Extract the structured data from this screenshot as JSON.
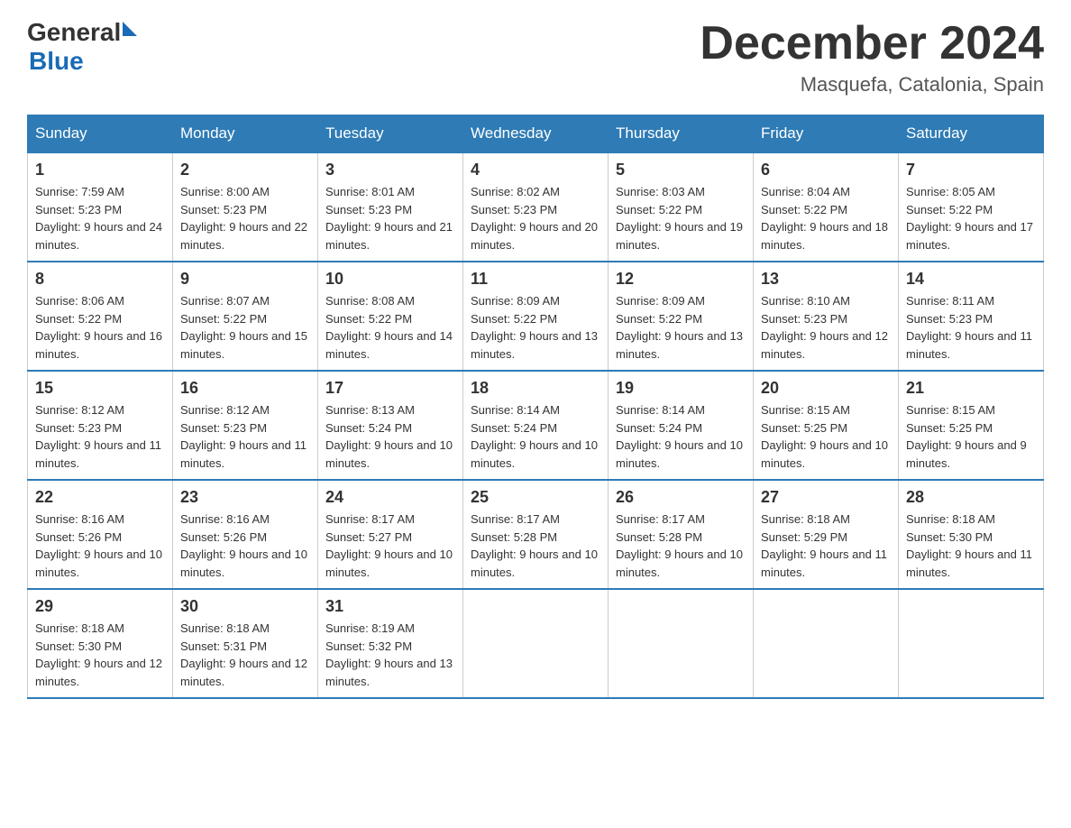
{
  "header": {
    "logo_general": "General",
    "logo_blue": "Blue",
    "month_title": "December 2024",
    "location": "Masquefa, Catalonia, Spain"
  },
  "calendar": {
    "columns": [
      "Sunday",
      "Monday",
      "Tuesday",
      "Wednesday",
      "Thursday",
      "Friday",
      "Saturday"
    ],
    "weeks": [
      [
        {
          "day": "1",
          "sunrise": "7:59 AM",
          "sunset": "5:23 PM",
          "daylight": "9 hours and 24 minutes."
        },
        {
          "day": "2",
          "sunrise": "8:00 AM",
          "sunset": "5:23 PM",
          "daylight": "9 hours and 22 minutes."
        },
        {
          "day": "3",
          "sunrise": "8:01 AM",
          "sunset": "5:23 PM",
          "daylight": "9 hours and 21 minutes."
        },
        {
          "day": "4",
          "sunrise": "8:02 AM",
          "sunset": "5:23 PM",
          "daylight": "9 hours and 20 minutes."
        },
        {
          "day": "5",
          "sunrise": "8:03 AM",
          "sunset": "5:22 PM",
          "daylight": "9 hours and 19 minutes."
        },
        {
          "day": "6",
          "sunrise": "8:04 AM",
          "sunset": "5:22 PM",
          "daylight": "9 hours and 18 minutes."
        },
        {
          "day": "7",
          "sunrise": "8:05 AM",
          "sunset": "5:22 PM",
          "daylight": "9 hours and 17 minutes."
        }
      ],
      [
        {
          "day": "8",
          "sunrise": "8:06 AM",
          "sunset": "5:22 PM",
          "daylight": "9 hours and 16 minutes."
        },
        {
          "day": "9",
          "sunrise": "8:07 AM",
          "sunset": "5:22 PM",
          "daylight": "9 hours and 15 minutes."
        },
        {
          "day": "10",
          "sunrise": "8:08 AM",
          "sunset": "5:22 PM",
          "daylight": "9 hours and 14 minutes."
        },
        {
          "day": "11",
          "sunrise": "8:09 AM",
          "sunset": "5:22 PM",
          "daylight": "9 hours and 13 minutes."
        },
        {
          "day": "12",
          "sunrise": "8:09 AM",
          "sunset": "5:22 PM",
          "daylight": "9 hours and 13 minutes."
        },
        {
          "day": "13",
          "sunrise": "8:10 AM",
          "sunset": "5:23 PM",
          "daylight": "9 hours and 12 minutes."
        },
        {
          "day": "14",
          "sunrise": "8:11 AM",
          "sunset": "5:23 PM",
          "daylight": "9 hours and 11 minutes."
        }
      ],
      [
        {
          "day": "15",
          "sunrise": "8:12 AM",
          "sunset": "5:23 PM",
          "daylight": "9 hours and 11 minutes."
        },
        {
          "day": "16",
          "sunrise": "8:12 AM",
          "sunset": "5:23 PM",
          "daylight": "9 hours and 11 minutes."
        },
        {
          "day": "17",
          "sunrise": "8:13 AM",
          "sunset": "5:24 PM",
          "daylight": "9 hours and 10 minutes."
        },
        {
          "day": "18",
          "sunrise": "8:14 AM",
          "sunset": "5:24 PM",
          "daylight": "9 hours and 10 minutes."
        },
        {
          "day": "19",
          "sunrise": "8:14 AM",
          "sunset": "5:24 PM",
          "daylight": "9 hours and 10 minutes."
        },
        {
          "day": "20",
          "sunrise": "8:15 AM",
          "sunset": "5:25 PM",
          "daylight": "9 hours and 10 minutes."
        },
        {
          "day": "21",
          "sunrise": "8:15 AM",
          "sunset": "5:25 PM",
          "daylight": "9 hours and 9 minutes."
        }
      ],
      [
        {
          "day": "22",
          "sunrise": "8:16 AM",
          "sunset": "5:26 PM",
          "daylight": "9 hours and 10 minutes."
        },
        {
          "day": "23",
          "sunrise": "8:16 AM",
          "sunset": "5:26 PM",
          "daylight": "9 hours and 10 minutes."
        },
        {
          "day": "24",
          "sunrise": "8:17 AM",
          "sunset": "5:27 PM",
          "daylight": "9 hours and 10 minutes."
        },
        {
          "day": "25",
          "sunrise": "8:17 AM",
          "sunset": "5:28 PM",
          "daylight": "9 hours and 10 minutes."
        },
        {
          "day": "26",
          "sunrise": "8:17 AM",
          "sunset": "5:28 PM",
          "daylight": "9 hours and 10 minutes."
        },
        {
          "day": "27",
          "sunrise": "8:18 AM",
          "sunset": "5:29 PM",
          "daylight": "9 hours and 11 minutes."
        },
        {
          "day": "28",
          "sunrise": "8:18 AM",
          "sunset": "5:30 PM",
          "daylight": "9 hours and 11 minutes."
        }
      ],
      [
        {
          "day": "29",
          "sunrise": "8:18 AM",
          "sunset": "5:30 PM",
          "daylight": "9 hours and 12 minutes."
        },
        {
          "day": "30",
          "sunrise": "8:18 AM",
          "sunset": "5:31 PM",
          "daylight": "9 hours and 12 minutes."
        },
        {
          "day": "31",
          "sunrise": "8:19 AM",
          "sunset": "5:32 PM",
          "daylight": "9 hours and 13 minutes."
        },
        null,
        null,
        null,
        null
      ]
    ]
  }
}
